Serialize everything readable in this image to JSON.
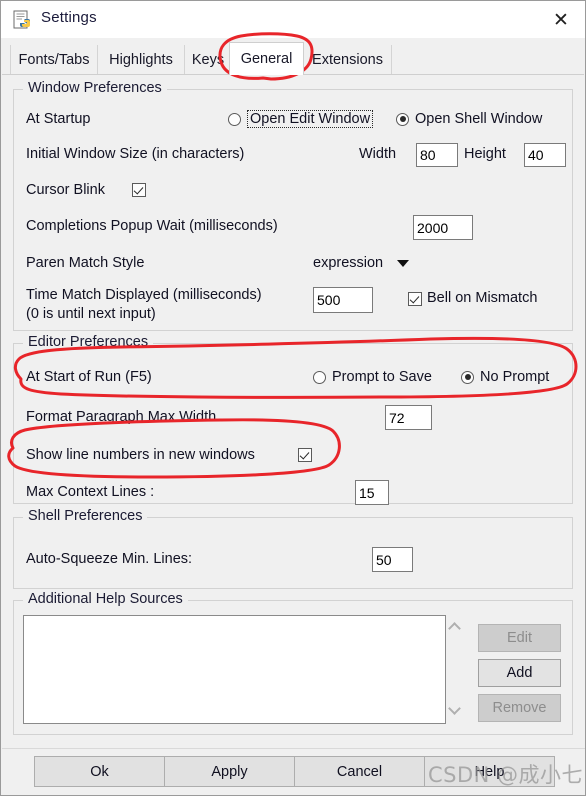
{
  "window": {
    "title": "Settings",
    "icon": "idle-python-icon",
    "close_label": "✕"
  },
  "tabs": [
    {
      "label": "Fonts/Tabs",
      "selected": false
    },
    {
      "label": "Highlights",
      "selected": false
    },
    {
      "label": "Keys",
      "selected": false
    },
    {
      "label": "General",
      "selected": true
    },
    {
      "label": "Extensions",
      "selected": false
    }
  ],
  "window_preferences": {
    "title": "Window Preferences",
    "at_startup_label": "At Startup",
    "startup_options": [
      {
        "label": "Open Edit Window",
        "selected": false,
        "focused": true
      },
      {
        "label": "Open Shell Window",
        "selected": true,
        "focused": false
      }
    ],
    "initial_window_size_label": "Initial Window Size  (in characters)",
    "width_label": "Width",
    "width_value": "80",
    "height_label": "Height",
    "height_value": "40",
    "cursor_blink_label": "Cursor Blink",
    "cursor_blink_checked": true,
    "completions_popup_label": "Completions Popup Wait (milliseconds)",
    "completions_popup_value": "2000",
    "paren_match_style_label": "Paren Match Style",
    "paren_match_style_value": "expression",
    "time_match_label_line1": "Time Match Displayed (milliseconds)",
    "time_match_label_line2": "(0 is until next input)",
    "time_match_value": "500",
    "bell_on_mismatch_label": "Bell on Mismatch",
    "bell_on_mismatch_checked": true
  },
  "editor_preferences": {
    "title": "Editor Preferences",
    "at_start_of_run_label": "At Start of Run (F5)",
    "run_options": [
      {
        "label": "Prompt to Save",
        "selected": false
      },
      {
        "label": "No Prompt",
        "selected": true
      }
    ],
    "format_paragraph_label": "Format Paragraph Max Width",
    "format_paragraph_value": "72",
    "show_line_numbers_label": "Show line numbers in new windows",
    "show_line_numbers_checked": true,
    "max_context_lines_label": "Max Context Lines :",
    "max_context_lines_value": "15"
  },
  "shell_preferences": {
    "title": "Shell Preferences",
    "auto_squeeze_label": "Auto-Squeeze Min. Lines:",
    "auto_squeeze_value": "50"
  },
  "help_sources": {
    "title": "Additional Help Sources",
    "items": [],
    "buttons": [
      {
        "label": "Edit",
        "enabled": false
      },
      {
        "label": "Add",
        "enabled": true
      },
      {
        "label": "Remove",
        "enabled": false
      }
    ]
  },
  "dialog_buttons": [
    {
      "label": "Ok"
    },
    {
      "label": "Apply"
    },
    {
      "label": "Cancel"
    },
    {
      "label": "Help"
    }
  ],
  "watermark": {
    "text": "CSDN @成小七"
  },
  "annotation_color": "#e8252a"
}
